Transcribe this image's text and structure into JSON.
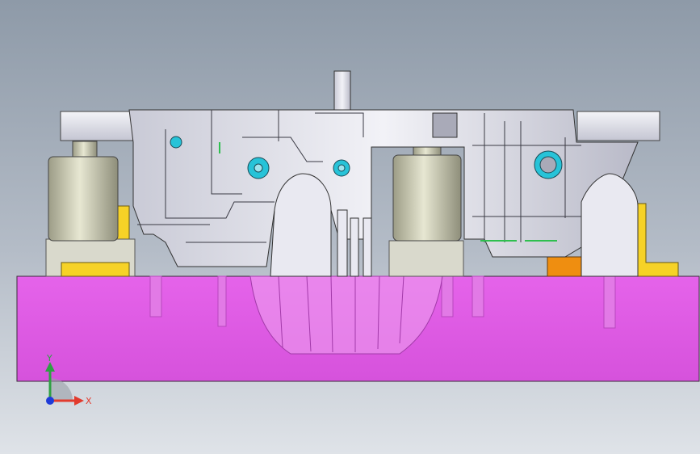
{
  "view": {
    "background_top": "#8e9aa8",
    "background_bottom": "#dfe3e8",
    "bottom_plate_color": "#e05ce6",
    "guide_block_color": "#f6d227",
    "insert_color": "#ef8e10",
    "hole_color": "#27c3d8"
  },
  "triad": {
    "x_label": "X",
    "y_label": "Y",
    "x_color": "#e23b2e",
    "y_color": "#2ea043",
    "z_color": "#1f3bd8"
  }
}
